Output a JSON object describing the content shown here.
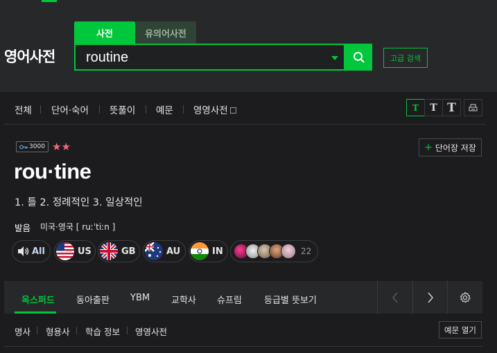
{
  "header": {
    "logo": "영어사전",
    "tabs": [
      "사전",
      "유의어사전"
    ],
    "search_value": "routine",
    "advanced_search": "고급 검색"
  },
  "categories": [
    "전체",
    "단어·숙어",
    "뜻풀이",
    "예문",
    "영영사전"
  ],
  "text_size_buttons": [
    "T",
    "T",
    "T"
  ],
  "entry": {
    "level_badge": "3000",
    "stars": "★★",
    "save_label": "단어장 저장",
    "headword": "rou·tine",
    "meanings": "1. 틀 2. 정례적인 3. 일상적인",
    "pron_label": "발음",
    "pron_region": "미국·영국 [ ruːˈtiːn ]",
    "audio": [
      {
        "label": "All",
        "icon": "speaker-icon"
      },
      {
        "label": "US",
        "icon": "us-flag-icon"
      },
      {
        "label": "GB",
        "icon": "gb-flag-icon"
      },
      {
        "label": "AU",
        "icon": "au-flag-icon"
      },
      {
        "label": "IN",
        "icon": "in-flag-icon"
      }
    ],
    "user_pron_count": "22"
  },
  "dict_tabs": [
    "옥스퍼드",
    "동아출판",
    "YBM",
    "교학사",
    "슈프림",
    "등급별 뜻보기"
  ],
  "pos_items": [
    "명사",
    "형용사",
    "학습 정보",
    "영영사전"
  ],
  "example_button": "예문 열기",
  "colors": {
    "accent": "#00c73c",
    "background": "#1c1c1e",
    "header": "#27282a",
    "star": "#f06c7c"
  }
}
